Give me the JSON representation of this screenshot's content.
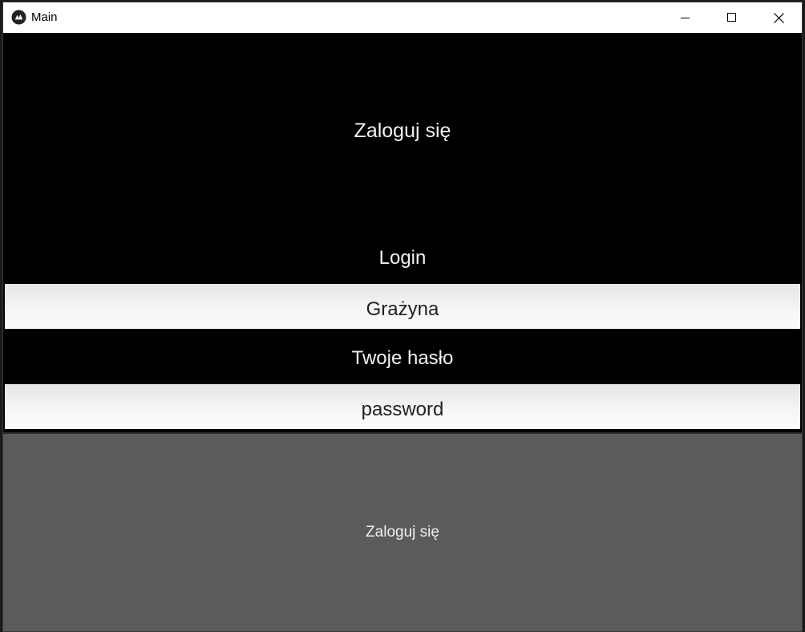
{
  "window": {
    "title": "Main",
    "icon": "kivy-logo-icon"
  },
  "titlebar_buttons": {
    "minimize_icon": "minimize-icon",
    "maximize_icon": "maximize-icon",
    "close_icon": "close-icon"
  },
  "form": {
    "heading": "Zaloguj się",
    "login_label": "Login",
    "login_value": "Grażyna",
    "password_label": "Twoje hasło",
    "password_value": "password",
    "submit_label": "Zaloguj się"
  },
  "colors": {
    "background": "#000000",
    "button": "#5b5b5b",
    "field": "#f4f4f4"
  }
}
